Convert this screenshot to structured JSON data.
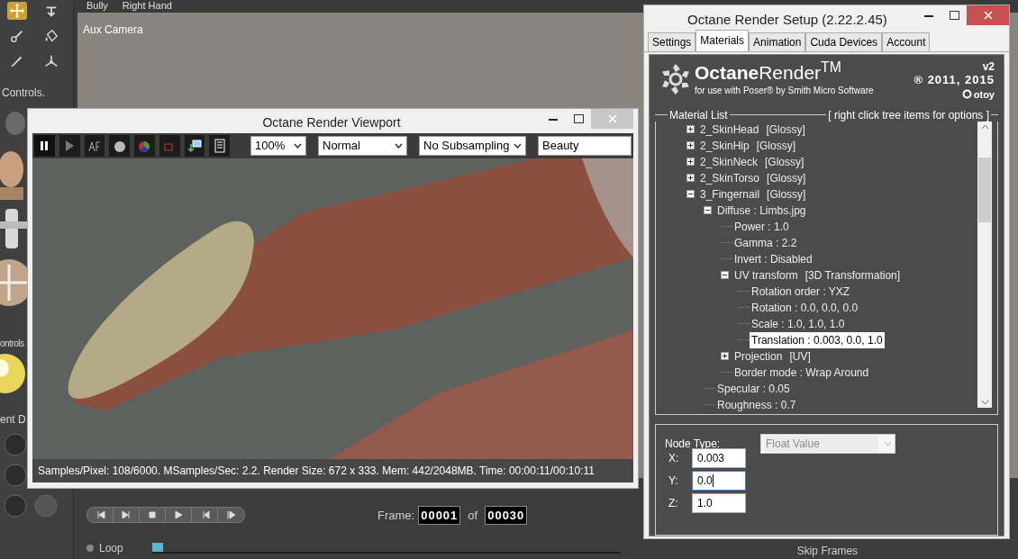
{
  "app": {
    "top_bar": [
      "Bully",
      "Right Hand"
    ],
    "camera_label": "Aux Camera",
    "tools": [
      {
        "selected": true
      },
      {
        "selected": false
      },
      {
        "selected": false
      },
      {
        "selected": false
      },
      {
        "selected": false
      },
      {
        "selected": false
      }
    ],
    "side_labels": [
      "Controls.",
      "ontrols",
      "ent D"
    ],
    "frame": {
      "label": "Frame:",
      "current": "00001",
      "of": "of",
      "total": "00030"
    },
    "loop": {
      "label": "Loop",
      "selected": false
    },
    "skip_frames": "Skip Frames",
    "timeline": {
      "level": 0
    }
  },
  "viewport": {
    "title": "Octane Render Viewport",
    "paused": true,
    "dropdowns": [
      {
        "value": "100%",
        "caret": true
      },
      {
        "value": "Normal",
        "caret": true
      },
      {
        "value": "No Subsampling",
        "caret": true
      },
      {
        "value": "Beauty",
        "caret": false
      }
    ],
    "status": "Samples/Pixel: 108/6000. MSamples/Sec: 2.2. Render Size: 672 x 333. Mem: 442/2048MB. Time: 00:00:11/00:10:11"
  },
  "setup": {
    "title": "Octane Render Setup (2.22.2.45)",
    "tabs": [
      {
        "label": "Settings",
        "selected": false
      },
      {
        "label": "Materials",
        "selected": true
      },
      {
        "label": "Animation",
        "selected": false
      },
      {
        "label": "Cuda Devices",
        "selected": false
      },
      {
        "label": "Account",
        "selected": false
      }
    ],
    "banner": {
      "brand": "**Octane**Render$^{TM}$",
      "subtitle": "for use with Poser® by Smith Micro Software",
      "version": "v2",
      "copyright": "® 2011, 2015",
      "company": "otoy"
    },
    "material_list": {
      "title": "Material List",
      "hint": "[ right click tree items for options ]",
      "items": [
        {
          "label": "2_SkinHead",
          "tag": "[Glossy]",
          "expanded": false,
          "selected": false
        },
        {
          "label": "2_SkinHip",
          "tag": "[Glossy]",
          "expanded": false,
          "selected": false
        },
        {
          "label": "2_SkinNeck",
          "tag": "[Glossy]",
          "expanded": false,
          "selected": false
        },
        {
          "label": "2_SkinTorso",
          "tag": "[Glossy]",
          "expanded": false,
          "selected": false
        },
        {
          "label": "3_Fingernail",
          "tag": "[Glossy]",
          "expanded": true,
          "selected": false,
          "children": [
            {
              "label": "Diffuse : Limbs.jpg",
              "expanded": true,
              "selected": false,
              "children": [
                {
                  "label": "Power : 1.0",
                  "selected": false
                },
                {
                  "label": "Gamma : 2.2",
                  "selected": false
                },
                {
                  "label": "Invert : Disabled",
                  "selected": false
                },
                {
                  "label": "UV transform",
                  "tag": "[3D Transformation]",
                  "expanded": true,
                  "selected": false,
                  "children": [
                    {
                      "label": "Rotation order : YXZ",
                      "selected": false
                    },
                    {
                      "label": "Rotation : 0.0, 0.0, 0.0",
                      "selected": false
                    },
                    {
                      "label": "Scale : 1.0, 1.0, 1.0",
                      "selected": false
                    },
                    {
                      "label": "Translation : 0.003, 0.0, 1.0",
                      "selected": true
                    }
                  ]
                },
                {
                  "label": "Projection",
                  "tag": "[UV]",
                  "expanded": false,
                  "selected": false
                },
                {
                  "label": "Border mode : Wrap Around",
                  "selected": false
                }
              ]
            },
            {
              "label": "Specular : 0.05",
              "selected": false
            },
            {
              "label": "Roughness : 0.7",
              "selected": false
            }
          ]
        }
      ]
    },
    "node": {
      "type_label": "Node Type:",
      "type_value": "Float Value",
      "type_disabled": true,
      "fields": [
        {
          "label": "X:",
          "value": "0.003",
          "focused": false
        },
        {
          "label": "Y:",
          "value": "0.0",
          "focused": true
        },
        {
          "label": "Z:",
          "value": "1.0",
          "focused": false
        }
      ]
    }
  }
}
